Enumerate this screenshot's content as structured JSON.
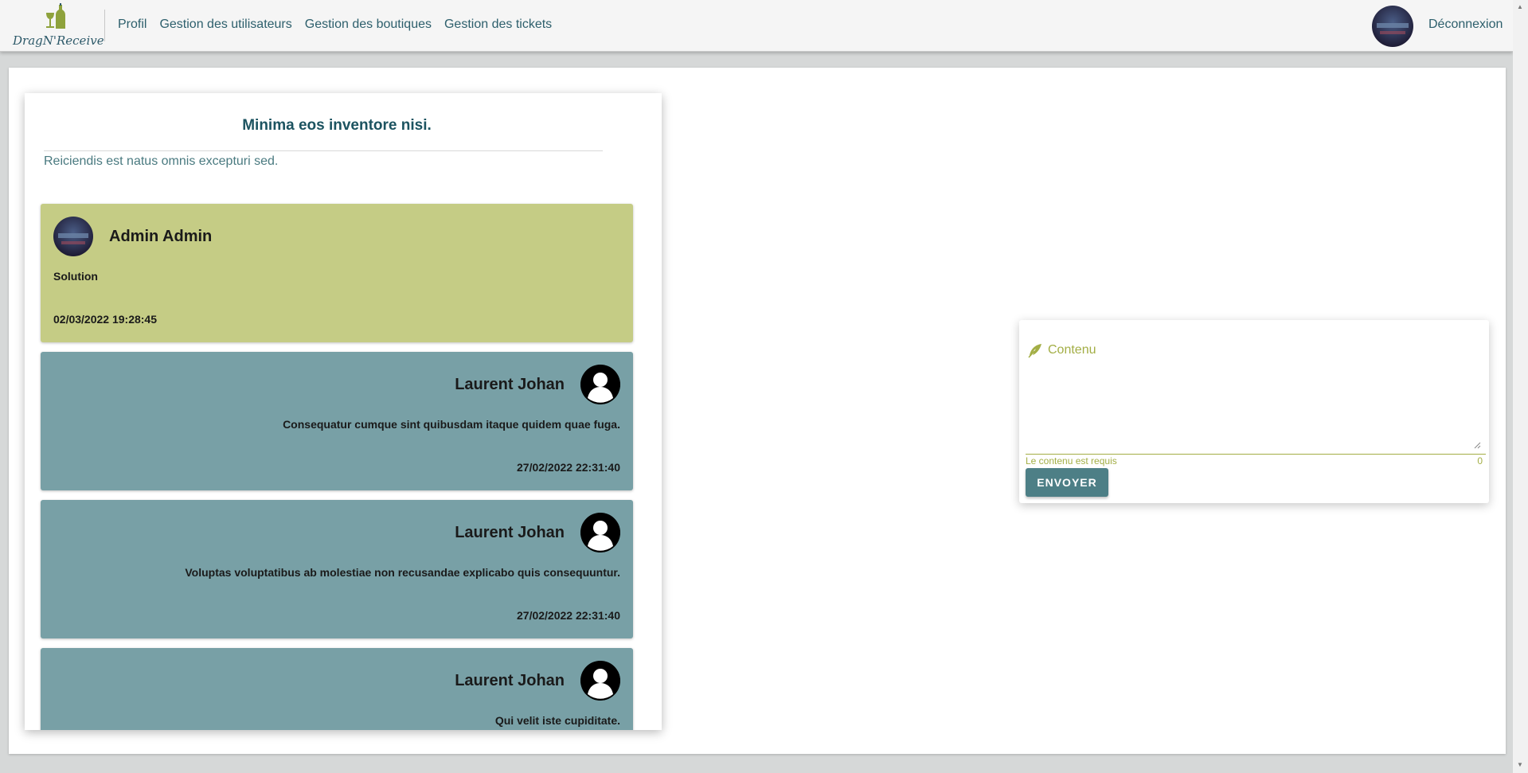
{
  "navbar": {
    "logo_text": "DragN'Receive",
    "links": [
      "Profil",
      "Gestion des utilisateurs",
      "Gestion des boutiques",
      "Gestion des tickets"
    ],
    "logout_label": "Déconnexion"
  },
  "ticket": {
    "title": "Minima eos inventore nisi.",
    "description": "Reiciendis est natus omnis excepturi sed.",
    "messages": [
      {
        "author": "Admin Admin",
        "body": "Solution",
        "date": "02/03/2022 19:28:45",
        "role": "admin"
      },
      {
        "author": "Laurent Johan",
        "body": "Consequatur cumque sint quibusdam itaque quidem quae fuga.",
        "date": "27/02/2022 22:31:40",
        "role": "user"
      },
      {
        "author": "Laurent Johan",
        "body": "Voluptas voluptatibus ab molestiae non recusandae explicabo quis consequuntur.",
        "date": "27/02/2022 22:31:40",
        "role": "user"
      },
      {
        "author": "Laurent Johan",
        "body": "Qui velit iste cupiditate.",
        "date": "",
        "role": "user"
      }
    ]
  },
  "reply_form": {
    "label": "Contenu",
    "value": "",
    "error": "Le contenu est requis",
    "char_count": "0",
    "submit_label": "ENVOYER"
  },
  "colors": {
    "brand": "#2d5f6c",
    "admin_message": "#c5cc85",
    "user_message": "#78a0a6",
    "accent_olive": "#a3ae45",
    "button": "#4d7f86"
  },
  "icons": {
    "logo": "bottle-glass-icon",
    "field": "feather-icon",
    "user_avatar": "user-silhouette-icon"
  }
}
